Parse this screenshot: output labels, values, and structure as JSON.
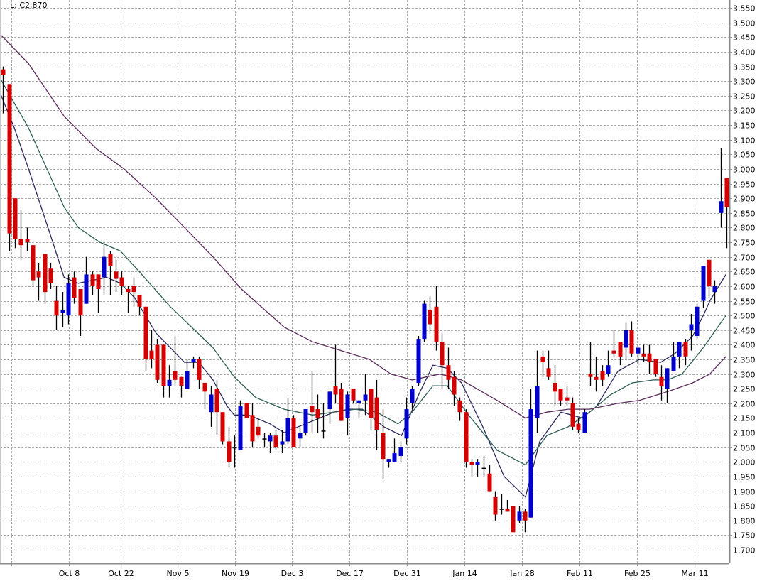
{
  "header": {
    "last_label": "L: C2.870"
  },
  "chart_data": {
    "type": "candlestick",
    "title": "",
    "ylim": [
      1.654,
      3.577
    ],
    "grid": true,
    "colors": {
      "up": "#0000cc",
      "down": "#d40000",
      "wick": "#000000",
      "grid": "#a8a8a8",
      "axis": "#8c8c8c",
      "ma_fast": "#2a2a5c",
      "ma_medium": "#2e5e56",
      "ma_slow": "#5c2c5c"
    },
    "y_ticks": [
      "3.550",
      "3.500",
      "3.450",
      "3.400",
      "3.350",
      "3.300",
      "3.250",
      "3.200",
      "3.150",
      "3.100",
      "3.050",
      "3.000",
      "2.950",
      "2.900",
      "2.850",
      "2.800",
      "2.750",
      "2.700",
      "2.650",
      "2.600",
      "2.550",
      "2.500",
      "2.450",
      "2.400",
      "2.350",
      "2.300",
      "2.250",
      "2.200",
      "2.150",
      "2.100",
      "2.050",
      "2.000",
      "1.950",
      "1.900",
      "1.850",
      "1.800",
      "1.750",
      "1.700"
    ],
    "x_ticks": [
      {
        "label": "",
        "index": 1.4
      },
      {
        "label": "Oct 8",
        "index": 11.1
      },
      {
        "label": "Oct 22",
        "index": 19.8
      },
      {
        "label": "Nov 5",
        "index": 29.4
      },
      {
        "label": "Nov 19",
        "index": 39.1
      },
      {
        "label": "Dec 3",
        "index": 48.7
      },
      {
        "label": "Dec 17",
        "index": 58.4
      },
      {
        "label": "Dec 31",
        "index": 68.1
      },
      {
        "label": "Jan 14",
        "index": 77.8
      },
      {
        "label": "Jan 28",
        "index": 87.5
      },
      {
        "label": "Feb 11",
        "index": 97.2
      },
      {
        "label": "Feb 25",
        "index": 106.9
      },
      {
        "label": "Mar 11",
        "index": 116.6
      }
    ],
    "ohlc_fields": [
      "open",
      "high",
      "low",
      "close"
    ],
    "candles": [
      [
        3.34,
        3.35,
        3.19,
        3.32
      ],
      [
        3.29,
        3.29,
        2.72,
        2.78
      ],
      [
        2.9,
        2.9,
        2.73,
        2.76
      ],
      [
        2.76,
        2.86,
        2.69,
        2.74
      ],
      [
        2.76,
        2.8,
        2.72,
        2.75
      ],
      [
        2.74,
        2.74,
        2.6,
        2.62
      ],
      [
        2.65,
        2.68,
        2.55,
        2.63
      ],
      [
        2.71,
        2.71,
        2.54,
        2.58
      ],
      [
        2.66,
        2.68,
        2.59,
        2.61
      ],
      [
        2.55,
        2.6,
        2.45,
        2.5
      ],
      [
        2.51,
        2.58,
        2.46,
        2.52
      ],
      [
        2.5,
        2.64,
        2.47,
        2.61
      ],
      [
        2.63,
        2.65,
        2.54,
        2.56
      ],
      [
        2.59,
        2.59,
        2.43,
        2.5
      ],
      [
        2.54,
        2.7,
        2.54,
        2.64
      ],
      [
        2.64,
        2.65,
        2.57,
        2.6
      ],
      [
        2.64,
        2.64,
        2.51,
        2.59
      ],
      [
        2.63,
        2.75,
        2.57,
        2.7
      ],
      [
        2.71,
        2.72,
        2.57,
        2.67
      ],
      [
        2.65,
        2.69,
        2.58,
        2.625
      ],
      [
        2.63,
        2.65,
        2.57,
        2.6
      ],
      [
        2.59,
        2.6,
        2.51,
        2.58
      ],
      [
        2.6,
        2.63,
        2.53,
        2.58
      ],
      [
        2.57,
        2.57,
        2.5,
        2.53
      ],
      [
        2.53,
        2.53,
        2.31,
        2.35
      ],
      [
        2.38,
        2.45,
        2.32,
        2.35
      ],
      [
        2.4,
        2.42,
        2.27,
        2.28
      ],
      [
        2.4,
        2.4,
        2.22,
        2.26
      ],
      [
        2.26,
        2.33,
        2.22,
        2.28
      ],
      [
        2.31,
        2.43,
        2.26,
        2.28
      ],
      [
        2.29,
        2.29,
        2.22,
        2.26
      ],
      [
        2.25,
        2.35,
        2.25,
        2.31
      ],
      [
        2.34,
        2.36,
        2.32,
        2.35
      ],
      [
        2.35,
        2.36,
        2.25,
        2.28
      ],
      [
        2.27,
        2.27,
        2.18,
        2.24
      ],
      [
        2.17,
        2.26,
        2.12,
        2.23
      ],
      [
        2.25,
        2.28,
        2.09,
        2.17
      ],
      [
        2.17,
        2.17,
        2.06,
        2.07
      ],
      [
        2.07,
        2.12,
        1.98,
        2.0
      ],
      [
        2.05,
        2.09,
        1.98,
        2.05
      ],
      [
        2.04,
        2.21,
        2.04,
        2.19
      ],
      [
        2.2,
        2.2,
        2.15,
        2.15
      ],
      [
        2.16,
        2.2,
        2.05,
        2.07
      ],
      [
        2.12,
        2.15,
        2.08,
        2.09
      ],
      [
        2.08,
        2.1,
        2.05,
        2.08
      ],
      [
        2.07,
        2.1,
        2.03,
        2.09
      ],
      [
        2.09,
        2.11,
        2.04,
        2.05
      ],
      [
        2.06,
        2.11,
        2.03,
        2.07
      ],
      [
        2.07,
        2.22,
        2.06,
        2.15
      ],
      [
        2.15,
        2.16,
        2.05,
        2.05
      ],
      [
        2.08,
        2.12,
        2.05,
        2.1
      ],
      [
        2.1,
        2.18,
        2.09,
        2.18
      ],
      [
        2.19,
        2.31,
        2.1,
        2.17
      ],
      [
        2.18,
        2.23,
        2.1,
        2.15
      ],
      [
        2.107,
        2.2,
        2.08,
        2.107
      ],
      [
        2.18,
        2.24,
        2.13,
        2.24
      ],
      [
        2.26,
        2.4,
        2.2,
        2.23
      ],
      [
        2.25,
        2.27,
        2.14,
        2.14
      ],
      [
        2.15,
        2.24,
        2.09,
        2.23
      ],
      [
        2.25,
        2.25,
        2.2,
        2.21
      ],
      [
        2.2,
        2.21,
        2.15,
        2.21
      ],
      [
        2.21,
        2.3,
        2.16,
        2.23
      ],
      [
        2.25,
        2.25,
        2.11,
        2.15
      ],
      [
        2.22,
        2.28,
        2.04,
        2.11
      ],
      [
        2.1,
        2.18,
        1.94,
        2.01
      ],
      [
        2.0,
        2.01,
        1.98,
        2.01
      ],
      [
        2.0,
        2.08,
        2.0,
        2.03
      ],
      [
        2.02,
        2.07,
        1.998,
        2.05
      ],
      [
        2.08,
        2.22,
        2.06,
        2.18
      ],
      [
        2.2,
        2.26,
        2.18,
        2.25
      ],
      [
        2.27,
        2.43,
        2.26,
        2.42
      ],
      [
        2.42,
        2.55,
        2.41,
        2.54
      ],
      [
        2.52,
        2.565,
        2.44,
        2.47
      ],
      [
        2.53,
        2.6,
        2.38,
        2.41
      ],
      [
        2.41,
        2.44,
        2.25,
        2.33
      ],
      [
        2.33,
        2.39,
        2.25,
        2.28
      ],
      [
        2.29,
        2.31,
        2.19,
        2.23
      ],
      [
        2.21,
        2.22,
        2.14,
        2.17
      ],
      [
        2.17,
        2.18,
        1.98,
        2.0
      ],
      [
        2.0,
        2.01,
        1.95,
        1.99
      ],
      [
        1.99,
        2.01,
        1.95,
        2.0
      ],
      [
        1.98,
        2.02,
        1.95,
        1.98
      ],
      [
        1.96,
        1.99,
        1.9,
        1.9
      ],
      [
        1.88,
        1.9,
        1.8,
        1.82
      ],
      [
        1.84,
        1.89,
        1.82,
        1.84
      ],
      [
        1.84,
        1.87,
        1.83,
        1.83
      ],
      [
        1.85,
        1.85,
        1.76,
        1.76
      ],
      [
        1.8,
        1.85,
        1.79,
        1.83
      ],
      [
        1.83,
        1.84,
        1.76,
        1.8
      ],
      [
        1.81,
        2.25,
        1.81,
        2.18
      ],
      [
        2.15,
        2.38,
        2.1,
        2.26
      ],
      [
        2.36,
        2.38,
        2.29,
        2.34
      ],
      [
        2.32,
        2.38,
        2.28,
        2.29
      ],
      [
        2.27,
        2.33,
        2.19,
        2.24
      ],
      [
        2.25,
        2.25,
        2.19,
        2.21
      ],
      [
        2.22,
        2.26,
        2.19,
        2.21
      ],
      [
        2.2,
        2.22,
        2.11,
        2.12
      ],
      [
        2.13,
        2.15,
        2.1,
        2.11
      ],
      [
        2.1,
        2.18,
        2.1,
        2.17
      ],
      [
        2.3,
        2.41,
        2.26,
        2.29
      ],
      [
        2.29,
        2.36,
        2.24,
        2.28
      ],
      [
        2.31,
        2.33,
        2.26,
        2.28
      ],
      [
        2.3,
        2.38,
        2.29,
        2.33
      ],
      [
        2.38,
        2.45,
        2.36,
        2.37
      ],
      [
        2.41,
        2.41,
        2.33,
        2.36
      ],
      [
        2.39,
        2.475,
        2.35,
        2.45
      ],
      [
        2.45,
        2.48,
        2.36,
        2.37
      ],
      [
        2.37,
        2.39,
        2.33,
        2.39
      ],
      [
        2.37,
        2.4,
        2.34,
        2.36
      ],
      [
        2.37,
        2.4,
        2.3,
        2.34
      ],
      [
        2.35,
        2.35,
        2.29,
        2.3
      ],
      [
        2.29,
        2.33,
        2.21,
        2.26
      ],
      [
        2.25,
        2.32,
        2.2,
        2.32
      ],
      [
        2.31,
        2.41,
        2.31,
        2.36
      ],
      [
        2.36,
        2.41,
        2.32,
        2.41
      ],
      [
        2.41,
        2.42,
        2.33,
        2.36
      ],
      [
        2.45,
        2.505,
        2.38,
        2.47
      ],
      [
        2.43,
        2.54,
        2.42,
        2.53
      ],
      [
        2.55,
        2.67,
        2.525,
        2.67
      ],
      [
        2.69,
        2.69,
        2.56,
        2.6
      ],
      [
        2.58,
        2.62,
        2.54,
        2.6
      ],
      [
        2.85,
        3.07,
        2.8,
        2.89
      ],
      [
        2.97,
        2.97,
        2.73,
        2.87
      ]
    ],
    "moving_averages": [
      {
        "name": "ma_fast",
        "points": [
          [
            -0.5,
            3.26
          ],
          [
            1.9,
            3.14
          ],
          [
            4.3,
            3.0
          ],
          [
            7.9,
            2.78
          ],
          [
            10.3,
            2.63
          ],
          [
            12.7,
            2.61
          ],
          [
            15.1,
            2.62
          ],
          [
            17.5,
            2.63
          ],
          [
            19.8,
            2.61
          ],
          [
            22.2,
            2.56
          ],
          [
            25.8,
            2.44
          ],
          [
            30.6,
            2.34
          ],
          [
            33.0,
            2.34
          ],
          [
            35.4,
            2.28
          ],
          [
            37.8,
            2.19
          ],
          [
            39.0,
            2.16
          ],
          [
            41.4,
            2.16
          ],
          [
            45.0,
            2.13
          ],
          [
            47.4,
            2.1
          ],
          [
            49.8,
            2.12
          ],
          [
            53.4,
            2.15
          ],
          [
            55.8,
            2.17
          ],
          [
            58.2,
            2.18
          ],
          [
            60.6,
            2.18
          ],
          [
            64.2,
            2.12
          ],
          [
            67.2,
            2.09
          ],
          [
            70.1,
            2.23
          ],
          [
            72.5,
            2.33
          ],
          [
            74.9,
            2.32
          ],
          [
            77.3,
            2.27
          ],
          [
            80.9,
            2.12
          ],
          [
            84.5,
            1.95
          ],
          [
            88.1,
            1.88
          ],
          [
            90.5,
            2.07
          ],
          [
            94.1,
            2.17
          ],
          [
            97.7,
            2.15
          ],
          [
            100.1,
            2.19
          ],
          [
            103.7,
            2.31
          ],
          [
            107.3,
            2.35
          ],
          [
            110.9,
            2.34
          ],
          [
            113.3,
            2.37
          ],
          [
            116.3,
            2.43
          ],
          [
            118.1,
            2.5
          ],
          [
            119.2,
            2.55
          ],
          [
            121.9,
            2.64
          ]
        ]
      },
      {
        "name": "ma_medium",
        "points": [
          [
            -0.5,
            3.31
          ],
          [
            4.3,
            3.14
          ],
          [
            10.3,
            2.87
          ],
          [
            12.7,
            2.8
          ],
          [
            16.3,
            2.75
          ],
          [
            19.8,
            2.72
          ],
          [
            23.4,
            2.64
          ],
          [
            28.2,
            2.53
          ],
          [
            31.8,
            2.46
          ],
          [
            35.4,
            2.39
          ],
          [
            39.0,
            2.29
          ],
          [
            42.6,
            2.22
          ],
          [
            47.4,
            2.18
          ],
          [
            49.8,
            2.17
          ],
          [
            52.2,
            2.16
          ],
          [
            55.8,
            2.17
          ],
          [
            59.4,
            2.18
          ],
          [
            63.0,
            2.17
          ],
          [
            66.6,
            2.13
          ],
          [
            69.0,
            2.17
          ],
          [
            72.5,
            2.26
          ],
          [
            74.9,
            2.26
          ],
          [
            78.5,
            2.16
          ],
          [
            83.3,
            2.04
          ],
          [
            88.1,
            1.99
          ],
          [
            91.7,
            2.09
          ],
          [
            95.3,
            2.12
          ],
          [
            98.9,
            2.17
          ],
          [
            102.5,
            2.23
          ],
          [
            106.1,
            2.27
          ],
          [
            109.7,
            2.28
          ],
          [
            112.1,
            2.28
          ],
          [
            114.5,
            2.3
          ],
          [
            118.1,
            2.39
          ],
          [
            121.9,
            2.5
          ]
        ]
      },
      {
        "name": "ma_slow",
        "points": [
          [
            -0.5,
            3.46
          ],
          [
            4.3,
            3.36
          ],
          [
            10.3,
            3.18
          ],
          [
            15.7,
            3.07
          ],
          [
            20.4,
            3.0
          ],
          [
            25.8,
            2.9
          ],
          [
            30.6,
            2.8
          ],
          [
            35.4,
            2.7
          ],
          [
            40.2,
            2.59
          ],
          [
            47.4,
            2.46
          ],
          [
            52.2,
            2.41
          ],
          [
            57.0,
            2.38
          ],
          [
            61.8,
            2.35
          ],
          [
            65.4,
            2.3
          ],
          [
            69.0,
            2.28
          ],
          [
            73.7,
            2.3
          ],
          [
            77.3,
            2.28
          ],
          [
            83.3,
            2.21
          ],
          [
            88.1,
            2.15
          ],
          [
            91.7,
            2.17
          ],
          [
            95.3,
            2.18
          ],
          [
            98.9,
            2.18
          ],
          [
            103.7,
            2.2
          ],
          [
            107.3,
            2.21
          ],
          [
            112.1,
            2.24
          ],
          [
            116.3,
            2.27
          ],
          [
            119.2,
            2.3
          ],
          [
            121.9,
            2.36
          ]
        ]
      }
    ]
  }
}
